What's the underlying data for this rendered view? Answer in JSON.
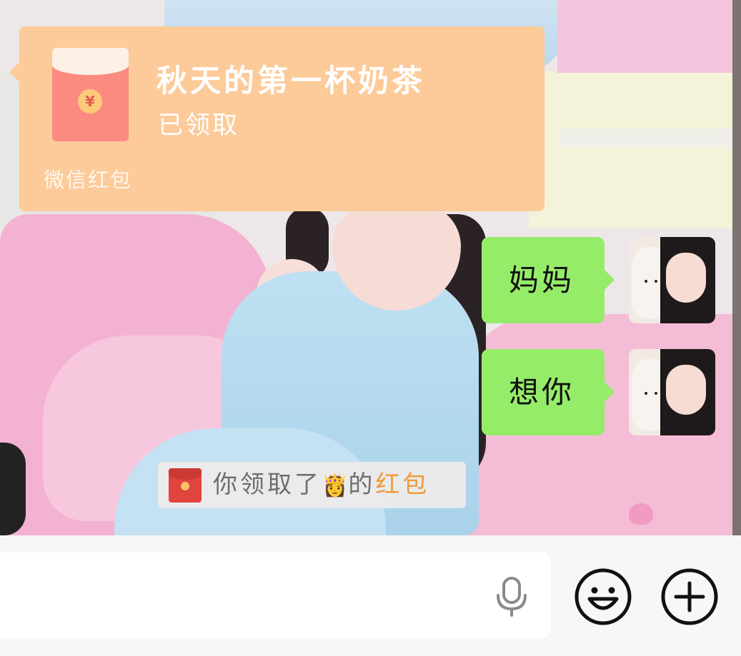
{
  "red_packet": {
    "title": "秋天的第一杯奶茶",
    "status": "已领取",
    "footer": "微信红包",
    "coin_symbol": "¥"
  },
  "messages": [
    {
      "text": "妈妈"
    },
    {
      "text": "想你"
    }
  ],
  "system_notice": {
    "prefix": "你领取了",
    "emoji": "👸",
    "middle": "的",
    "link": "红包"
  },
  "input_bar": {
    "text_value": "",
    "icons": [
      "microphone-icon",
      "smiley-icon",
      "plus-icon"
    ]
  },
  "colors": {
    "red_packet_bg": "#fccb99",
    "bubble_green": "#95ec69",
    "link_orange": "#f09a3a",
    "envelope_red": "#fb8b81"
  }
}
